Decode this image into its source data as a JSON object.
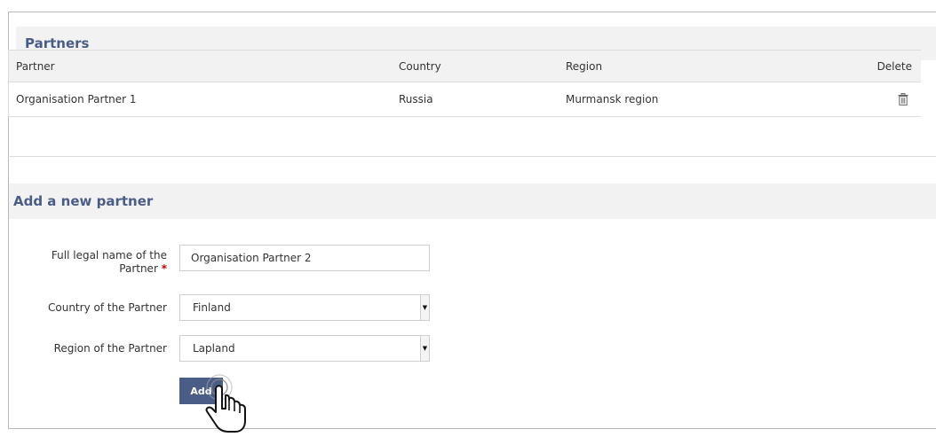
{
  "partners_section": {
    "title": "Partners",
    "columns": [
      "Partner",
      "Country",
      "Region",
      "Delete"
    ],
    "rows": [
      {
        "partner": "Organisation Partner 1",
        "country": "Russia",
        "region": "Murmansk region"
      }
    ]
  },
  "add_section": {
    "title": "Add a new partner",
    "fields": {
      "name_label": "Full legal name of the Partner",
      "name_required_mark": "*",
      "name_value": "Organisation Partner 2",
      "country_label": "Country of the Partner",
      "country_value": "Finland",
      "region_label": "Region of the Partner",
      "region_value": "Lapland"
    },
    "add_button_label": "Add"
  },
  "icons": {
    "delete": "trash-icon",
    "select_arrow": "caret-down-icon",
    "cursor": "hand-pointer-icon"
  },
  "colors": {
    "accent": "#4a5d86",
    "header_bg": "#f2f2f2",
    "required": "#c00000"
  }
}
